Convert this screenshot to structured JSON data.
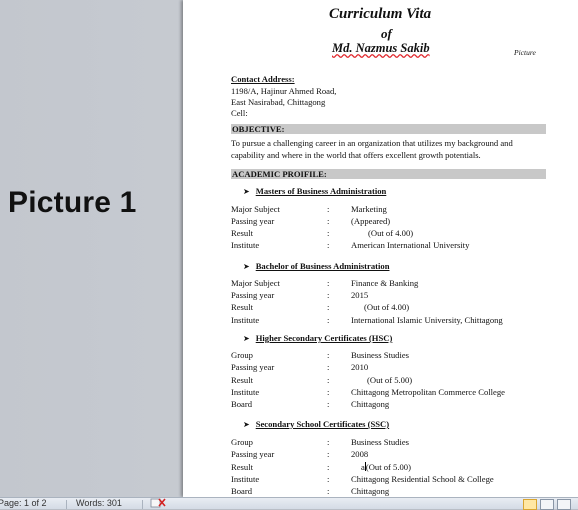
{
  "overlay_label": "Picture 1",
  "document": {
    "title_line1": "Curriculum Vita",
    "title_line2": "of",
    "name": "Md. Nazmus Sakib",
    "picture_placeholder": "Picture",
    "contact": {
      "heading": "Contact Address:",
      "line1": "1198/A, Hajinur Ahmed Road,",
      "line2": "East Nasirabad, Chittagong",
      "line3": "Cell:"
    },
    "objective": {
      "heading": "OBJECTIVE:",
      "line1": "To pursue a challenging career in an organization that utilizes my background and",
      "line2": "capability and where in the world that offers excellent growth potentials."
    },
    "academic_heading": "ACADEMIC PROIFILE:",
    "colon": ":",
    "degrees": [
      {
        "title": "Masters of Business Administration",
        "rows": [
          {
            "label": "Major Subject",
            "value": "Marketing"
          },
          {
            "label": "Passing year",
            "value": "(Appeared)"
          },
          {
            "label": "Result",
            "value": "(Out of 4.00)"
          },
          {
            "label": "Institute",
            "value": "American International University"
          }
        ]
      },
      {
        "title": "Bachelor of Business Administration",
        "rows": [
          {
            "label": "Major Subject",
            "value": "Finance & Banking"
          },
          {
            "label": "Passing year",
            "value": "2015"
          },
          {
            "label": "Result",
            "value": "(Out of 4.00)"
          },
          {
            "label": "Institute",
            "value": "International Islamic University, Chittagong"
          }
        ]
      },
      {
        "title": "Higher Secondary Certificates (HSC)",
        "rows": [
          {
            "label": "Group",
            "value": "Business Studies"
          },
          {
            "label": "Passing year",
            "value": "2010"
          },
          {
            "label": "Result",
            "value": "(Out of 5.00)"
          },
          {
            "label": "Institute",
            "value": "Chittagong Metropolitan Commerce College"
          },
          {
            "label": "Board",
            "value": "Chittagong"
          }
        ]
      },
      {
        "title": "Secondary School Certificates (SSC)",
        "rows": [
          {
            "label": "Group",
            "value": "Business Studies"
          },
          {
            "label": "Passing year",
            "value": "2008"
          },
          {
            "label": "Result",
            "value_prefix": "a",
            "value": "(Out of 5.00)"
          },
          {
            "label": "Institute",
            "value": "Chittagong Residential School & College"
          },
          {
            "label": "Board",
            "value": "Chittagong"
          }
        ]
      }
    ]
  },
  "statusbar": {
    "page": "Page: 1 of 2",
    "words": "Words: 301"
  },
  "icons": {
    "proofing": "proofing-error-icon",
    "print_layout": "print-layout-view-icon",
    "full_screen": "full-screen-reading-view-icon",
    "web_layout": "web-layout-view-icon"
  }
}
